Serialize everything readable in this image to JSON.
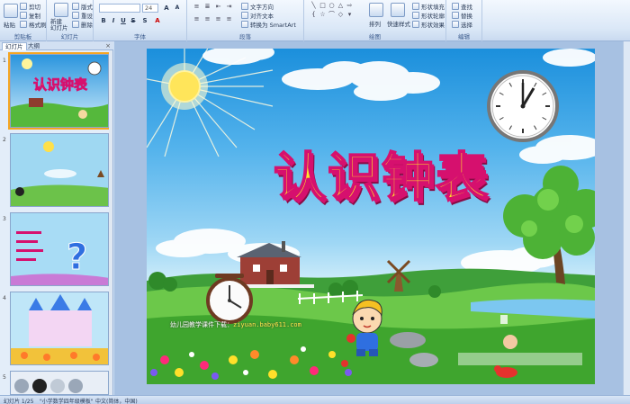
{
  "ribbon": {
    "clipboard": {
      "paste": "粘贴",
      "cut": "剪切",
      "copy": "复制",
      "format_painter": "格式刷",
      "label": "剪贴板"
    },
    "slides": {
      "new_slide": "新建\n幻灯片",
      "layout": "版式",
      "reset": "重设",
      "delete": "删除",
      "label": "幻灯片"
    },
    "font": {
      "name_value": "",
      "size_value": "24",
      "label": "字体"
    },
    "paragraph": {
      "text_direction": "文字方向",
      "align_text": "对齐文本",
      "smartart": "转换为 SmartArt",
      "label": "段落"
    },
    "drawing": {
      "arrange": "排列",
      "quick_styles": "快速样式",
      "shape_fill": "形状填充",
      "shape_outline": "形状轮廓",
      "shape_effects": "形状效果",
      "label": "绘图"
    },
    "editing": {
      "find": "查找",
      "replace": "替换",
      "select": "选择",
      "label": "编辑"
    }
  },
  "panel": {
    "tabs": {
      "slides": "幻灯片",
      "outline": "大纲",
      "close": "×"
    },
    "thumbnails": [
      {
        "num": "1",
        "title": "认识钟表"
      },
      {
        "num": "2",
        "title": ""
      },
      {
        "num": "3",
        "title": ""
      },
      {
        "num": "4",
        "title": ""
      },
      {
        "num": "5",
        "title": ""
      }
    ]
  },
  "slide": {
    "title": "认识钟表",
    "watermark_prefix": "幼儿园教学课件下载：",
    "watermark_url": "ziyuan.baby611.com"
  },
  "status": {
    "slide_counter": "幻灯片 1/25",
    "theme": "\"小学数学四年级模板\"",
    "language": "中文(简体，中国)"
  }
}
